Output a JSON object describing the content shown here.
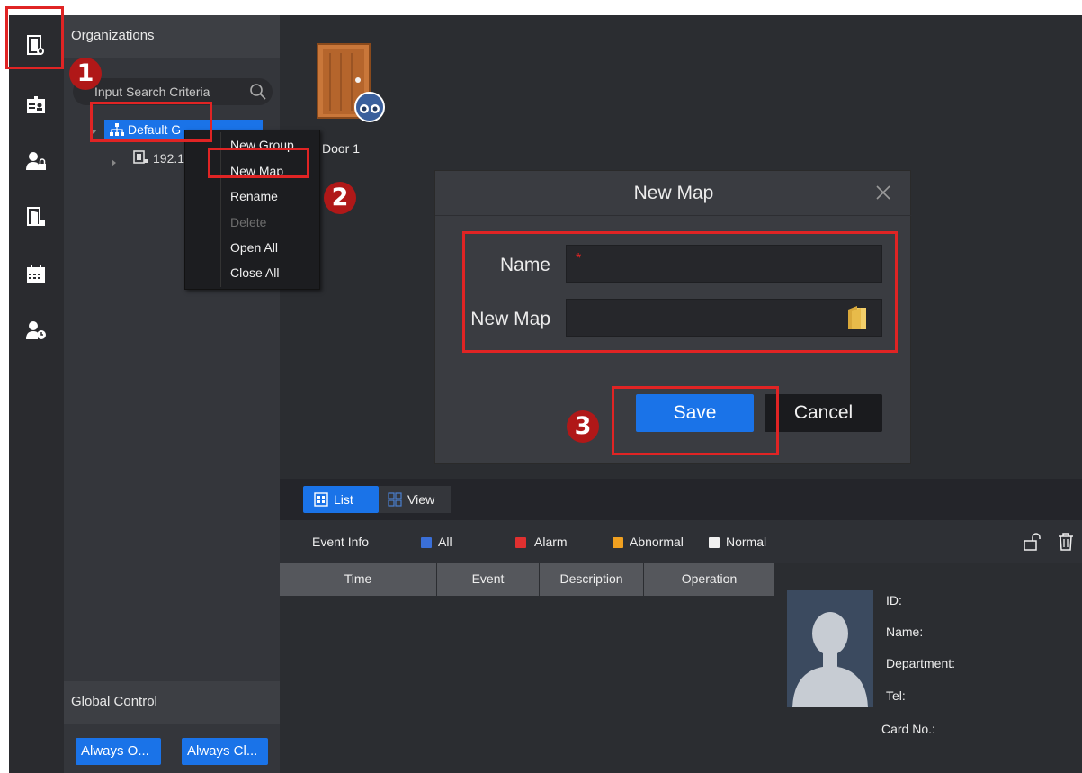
{
  "rail": {
    "icons": [
      "door-icon",
      "id-card-icon",
      "user-lock-icon",
      "door-lock-icon",
      "calendar-icon",
      "user-clock-icon"
    ]
  },
  "org_panel": {
    "title": "Organizations",
    "search_placeholder": "Input Search Criteria",
    "tree_root": "Default G",
    "tree_child": "192.1",
    "global_control": "Global Control",
    "always_open": "Always O...",
    "always_close": "Always Cl..."
  },
  "context_menu": {
    "items": [
      "New Group",
      "New Map",
      "Rename",
      "Delete",
      "Open All",
      "Close All"
    ],
    "disabled": [
      "Delete"
    ]
  },
  "door": {
    "label": "Door 1"
  },
  "dialog": {
    "title": "New Map",
    "name_label": "Name",
    "required_mark": "*",
    "map_label": "New Map",
    "save": "Save",
    "cancel": "Cancel"
  },
  "tabs": {
    "list": "List",
    "view": "View"
  },
  "event_bar": {
    "label": "Event Info",
    "all": "All",
    "alarm": "Alarm",
    "abnormal": "Abnormal",
    "normal": "Normal"
  },
  "table": {
    "columns": [
      "Time",
      "Event",
      "Description",
      "Operation"
    ]
  },
  "profile": {
    "id": "ID:",
    "name": "Name:",
    "department": "Department:",
    "tel": "Tel:",
    "card": "Card No.:"
  },
  "annotations": {
    "step1": "1",
    "step2": "2",
    "step3": "3"
  },
  "colors": {
    "accent": "#1a73e8",
    "annotation": "#e02424",
    "alarm": "#e03030",
    "abnormal": "#f0a020"
  }
}
